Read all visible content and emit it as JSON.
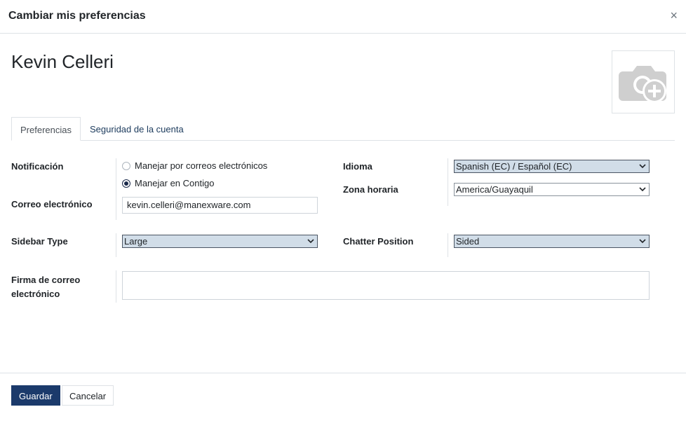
{
  "header": {
    "title": "Cambiar mis preferencias",
    "close_glyph": "×"
  },
  "user": {
    "name": "Kevin Celleri"
  },
  "avatar": {
    "icon": "camera-plus-icon"
  },
  "tabs": [
    {
      "label": "Preferencias",
      "active": true
    },
    {
      "label": "Seguridad de la cuenta",
      "active": false
    }
  ],
  "form": {
    "notification_label": "Notificación",
    "notification_options": [
      {
        "label": "Manejar por correos electrónicos",
        "checked": false
      },
      {
        "label": "Manejar en Contigo",
        "checked": true
      }
    ],
    "email_label": "Correo electrónico",
    "email_value": "kevin.celleri@manexware.com",
    "language_label": "Idioma",
    "language_value": "Spanish (EC) / Español (EC)",
    "timezone_label": "Zona horaria",
    "timezone_value": "America/Guayaquil",
    "sidebar_label": "Sidebar Type",
    "sidebar_value": "Large",
    "chatter_label": "Chatter Position",
    "chatter_value": "Sided",
    "signature_label_line1": "Firma de correo",
    "signature_label_line2": "electrónico",
    "signature_value": ""
  },
  "footer": {
    "save_label": "Guardar",
    "cancel_label": "Cancelar"
  },
  "colors": {
    "primary": "#1b3a6b",
    "highlight_select": "#d1dde8",
    "border": "#dee2e6"
  }
}
